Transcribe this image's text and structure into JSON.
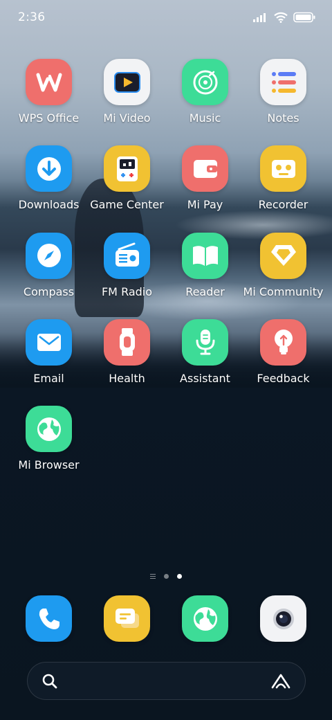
{
  "status_bar": {
    "time": "2:36"
  },
  "apps": [
    {
      "label": "WPS Office",
      "icon": "wps-office-icon",
      "color": "#ef6f6c"
    },
    {
      "label": "Mi Video",
      "icon": "mi-video-icon",
      "color": "#f2f3f5"
    },
    {
      "label": "Music",
      "icon": "music-icon",
      "color": "#3ddc97"
    },
    {
      "label": "Notes",
      "icon": "notes-icon",
      "color": "#f2f3f5"
    },
    {
      "label": "Downloads",
      "icon": "downloads-icon",
      "color": "#1e9bf0"
    },
    {
      "label": "Game Center",
      "icon": "game-center-icon",
      "color": "#f1c232"
    },
    {
      "label": "Mi Pay",
      "icon": "mi-pay-icon",
      "color": "#ef6f6c"
    },
    {
      "label": "Recorder",
      "icon": "recorder-icon",
      "color": "#f1c232"
    },
    {
      "label": "Compass",
      "icon": "compass-icon",
      "color": "#1e9bf0"
    },
    {
      "label": "FM Radio",
      "icon": "fm-radio-icon",
      "color": "#1e9bf0"
    },
    {
      "label": "Reader",
      "icon": "reader-icon",
      "color": "#3ddc97"
    },
    {
      "label": "Mi Community",
      "icon": "mi-community-icon",
      "color": "#f1c232"
    },
    {
      "label": "Email",
      "icon": "email-icon",
      "color": "#1e9bf0"
    },
    {
      "label": "Health",
      "icon": "health-icon",
      "color": "#ef6f6c"
    },
    {
      "label": "Assistant",
      "icon": "assistant-icon",
      "color": "#3ddc97"
    },
    {
      "label": "Feedback",
      "icon": "feedback-icon",
      "color": "#ef6f6c"
    },
    {
      "label": "Mi Browser",
      "icon": "mi-browser-icon",
      "color": "#3ddc97"
    }
  ],
  "pager": {
    "pages": 2,
    "active_page": 2
  },
  "dock": [
    {
      "icon": "phone-icon",
      "color": "#1e9bf0"
    },
    {
      "icon": "messages-icon",
      "color": "#f1c232"
    },
    {
      "icon": "browser-icon",
      "color": "#3ddc97"
    },
    {
      "icon": "camera-icon",
      "color": "#f2f3f5"
    }
  ],
  "search_bar": {
    "left_icon": "search-icon",
    "right_icon": "assistant-logo-icon"
  }
}
